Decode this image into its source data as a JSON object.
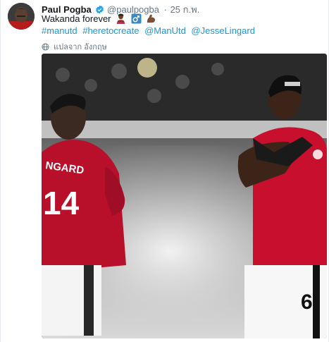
{
  "tweet": {
    "author_name": "Paul Pogba",
    "handle": "@paulpogba",
    "separator": "·",
    "timestamp": "25 ก.พ.",
    "text": "Wakanda forever",
    "hashtags": [
      "#manutd",
      "#heretocreate",
      "@ManUtd",
      "@JesseLingard"
    ],
    "translate_label": "แปลจาก อังกฤษ",
    "media": {
      "left_jersey_name": "NGARD",
      "left_jersey_number": "14",
      "right_jersey_number": "6"
    }
  },
  "colors": {
    "link": "#1b95e0",
    "verified": "#1da1f2",
    "secondary_text": "#657786",
    "jersey_red": "#c8102e"
  },
  "icons": {
    "verified": "verified-badge-icon",
    "emoji": [
      "crossed-arms-person-emoji",
      "male-sign-emoji",
      "flexed-biceps-emoji"
    ],
    "globe": "globe-icon"
  }
}
